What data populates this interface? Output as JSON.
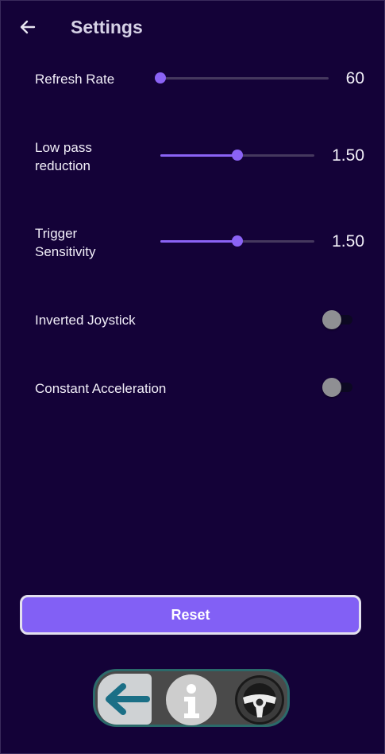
{
  "header": {
    "title": "Settings"
  },
  "sliders": [
    {
      "label": "Refresh Rate",
      "value": "60",
      "fraction": 0.0
    },
    {
      "label_line1": "Low pass",
      "label_line2": "reduction",
      "value": "1.50",
      "fraction": 0.5
    },
    {
      "label_line1": "Trigger",
      "label_line2": "Sensitivity",
      "value": "1.50",
      "fraction": 0.5
    }
  ],
  "toggles": [
    {
      "label": "Inverted Joystick",
      "on": false
    },
    {
      "label": "Constant Acceleration",
      "on": false
    }
  ],
  "reset": {
    "label": "Reset"
  },
  "colors": {
    "background": "#140238",
    "accent": "#8b63f5",
    "button": "#8260f5"
  },
  "bottom_nav": {
    "icons": [
      "back-arrow-icon",
      "info-icon",
      "steering-wheel-icon"
    ]
  }
}
